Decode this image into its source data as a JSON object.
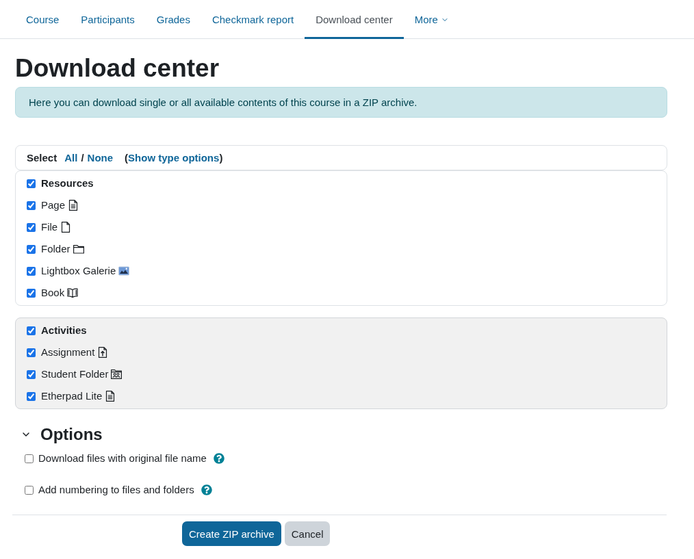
{
  "nav": {
    "tabs": [
      {
        "label": "Course",
        "selected": false,
        "kind": "link"
      },
      {
        "label": "Participants",
        "selected": false,
        "kind": "link"
      },
      {
        "label": "Grades",
        "selected": false,
        "kind": "link"
      },
      {
        "label": "Checkmark report",
        "selected": false,
        "kind": "link"
      },
      {
        "label": "Download center",
        "selected": true,
        "kind": "link"
      },
      {
        "label": "More",
        "selected": false,
        "kind": "menu"
      }
    ]
  },
  "page_title": "Download center",
  "info_alert": "Here you can download single or all available contents of this course in a ZIP archive.",
  "select_bar": {
    "label": "Select",
    "all_link": "All",
    "separator": "/",
    "none_link": "None",
    "type_options": {
      "prefix": "(",
      "link": "Show type options",
      "suffix": ")"
    }
  },
  "groups": [
    {
      "title": "Resources",
      "checked": true,
      "highlighted": false,
      "items": [
        {
          "label": "Page",
          "checked": true,
          "kind": "page"
        },
        {
          "label": "File",
          "checked": true,
          "kind": "file"
        },
        {
          "label": "Folder",
          "checked": true,
          "kind": "folder"
        },
        {
          "label": "Lightbox Galerie",
          "checked": true,
          "kind": "gallery"
        },
        {
          "label": "Book",
          "checked": true,
          "kind": "book"
        }
      ]
    },
    {
      "title": "Activities",
      "checked": true,
      "highlighted": true,
      "items": [
        {
          "label": "Assignment",
          "checked": true,
          "kind": "assignment"
        },
        {
          "label": "Student Folder",
          "checked": true,
          "kind": "studentfolder"
        },
        {
          "label": "Etherpad Lite",
          "checked": true,
          "kind": "etherpad"
        }
      ]
    }
  ],
  "options": {
    "title": "Options",
    "expanded": true,
    "items": [
      {
        "label": "Download files with original file name",
        "checked": false
      },
      {
        "label": "Add numbering to files and folders",
        "checked": false
      }
    ]
  },
  "buttons": [
    {
      "label": "Create ZIP archive",
      "kind": "primary"
    },
    {
      "label": "Cancel",
      "kind": "secondary"
    }
  ]
}
